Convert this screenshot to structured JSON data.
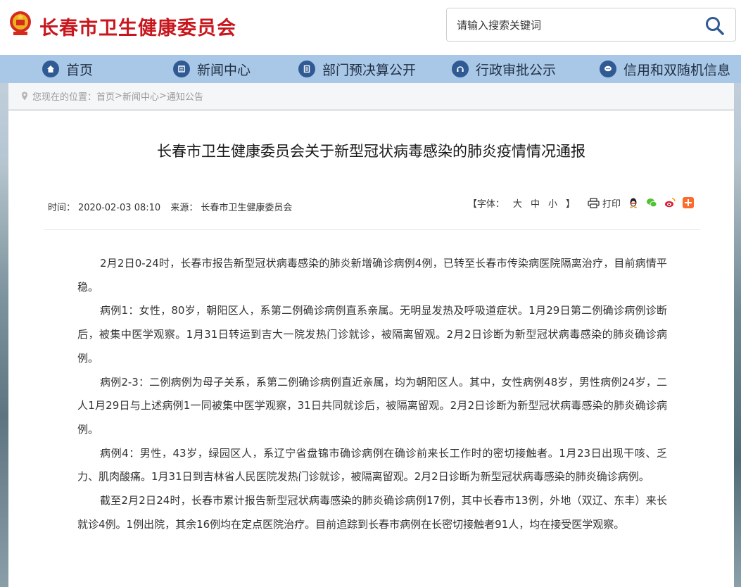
{
  "header": {
    "site_title": "长春市卫生健康委员会",
    "search_placeholder": "请输入搜索关键词"
  },
  "nav": {
    "items": [
      {
        "label": "首页",
        "icon": "home-icon"
      },
      {
        "label": "新闻中心",
        "icon": "news-icon"
      },
      {
        "label": "部门预决算公开",
        "icon": "budget-icon"
      },
      {
        "label": "行政审批公示",
        "icon": "approval-icon"
      },
      {
        "label": "信用和双随机信息",
        "icon": "credit-icon"
      }
    ]
  },
  "breadcrumb": {
    "prefix": "您现在的位置：",
    "items": [
      "首页",
      "新闻中心",
      "通知公告"
    ],
    "separator": ">"
  },
  "article": {
    "title": "长春市卫生健康委员会关于新型冠状病毒感染的肺炎疫情情况通报",
    "time_label": "时间：",
    "time_value": "2020-02-03 08:10",
    "source_label": "来源：",
    "source_value": "长春市卫生健康委员会",
    "font_label": "【字体：",
    "font_large": "大",
    "font_medium": "中",
    "font_small": "小",
    "font_close": "】",
    "print_label": "打印",
    "paragraphs": [
      "2月2日0-24时，长春市报告新型冠状病毒感染的肺炎新增确诊病例4例，已转至长春市传染病医院隔离治疗，目前病情平稳。",
      "病例1：女性，80岁，朝阳区人，系第二例确诊病例直系亲属。无明显发热及呼吸道症状。1月29日第二例确诊病例诊断后，被集中医学观察。1月31日转运到吉大一院发热门诊就诊，被隔离留观。2月2日诊断为新型冠状病毒感染的肺炎确诊病例。",
      "病例2-3：二例病例为母子关系，系第二例确诊病例直近亲属，均为朝阳区人。其中，女性病例48岁，男性病例24岁，二人1月29日与上述病例1一同被集中医学观察，31日共同就诊后，被隔离留观。2月2日诊断为新型冠状病毒感染的肺炎确诊病例。",
      "病例4：男性，43岁，绿园区人，系辽宁省盘锦市确诊病例在确诊前来长工作时的密切接触者。1月23日出现干咳、乏力、肌肉酸痛。1月31日到吉林省人民医院发热门诊就诊，被隔离留观。2月2日诊断为新型冠状病毒感染的肺炎确诊病例。",
      "截至2月2日24时，长春市累计报告新型冠状病毒感染的肺炎确诊病例17例，其中长春市13例，外地（双辽、东丰）来长就诊4例。1例出院，其余16例均在定点医院治疗。目前追踪到长春市病例在长密切接触者91人，均在接受医学观察。"
    ]
  },
  "colors": {
    "brand_red": "#c8161d",
    "nav_bg": "#a9c7e6",
    "nav_icon": "#2f5a93"
  }
}
